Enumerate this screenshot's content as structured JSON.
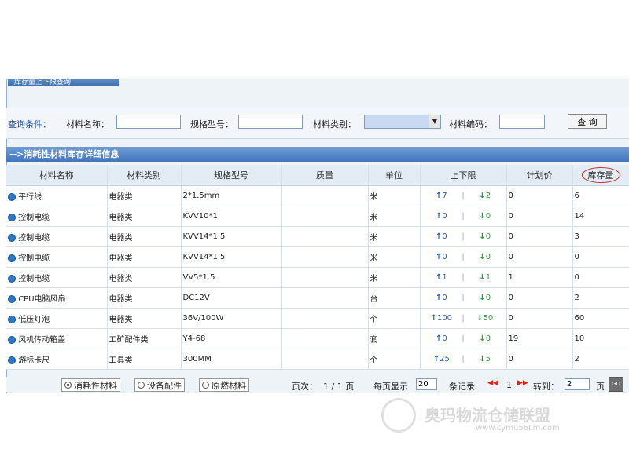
{
  "header_tab": "库存量上下限查询",
  "query": {
    "label": "查询条件：",
    "material_name_label": "材料名称：",
    "material_name_value": "",
    "spec_label": "规格型号：",
    "spec_value": "",
    "category_label": "材料类别：",
    "category_value": "",
    "code_label": "材料编码：",
    "code_value": "",
    "search_button": "查 询"
  },
  "section_title": "-->消耗性材料库存详细信息",
  "table": {
    "headers": [
      "材料名称",
      "材料类别",
      "规格型号",
      "质量",
      "单位",
      "上下限",
      "计划价",
      "库存量"
    ],
    "rows": [
      {
        "name": "平行线",
        "category": "电器类",
        "spec": "2*1.5mm",
        "quality": "",
        "unit": "米",
        "upper": "7",
        "lower": "2",
        "price": "0",
        "stock": "6"
      },
      {
        "name": "控制电缆",
        "category": "电器类",
        "spec": "KVV10*1",
        "quality": "",
        "unit": "米",
        "upper": "0",
        "lower": "0",
        "price": "0",
        "stock": "14"
      },
      {
        "name": "控制电缆",
        "category": "电器类",
        "spec": "KVV14*1.5",
        "quality": "",
        "unit": "米",
        "upper": "0",
        "lower": "0",
        "price": "0",
        "stock": "3"
      },
      {
        "name": "控制电缆",
        "category": "电器类",
        "spec": "KVV14*1.5",
        "quality": "",
        "unit": "米",
        "upper": "0",
        "lower": "0",
        "price": "0",
        "stock": "0"
      },
      {
        "name": "控制电缆",
        "category": "电器类",
        "spec": "VV5*1.5",
        "quality": "",
        "unit": "米",
        "upper": "1",
        "lower": "1",
        "price": "1",
        "stock": "0"
      },
      {
        "name": "CPU电脑风扇",
        "category": "电器类",
        "spec": "DC12V",
        "quality": "",
        "unit": "台",
        "upper": "0",
        "lower": "0",
        "price": "0",
        "stock": "2"
      },
      {
        "name": "低压灯泡",
        "category": "电器类",
        "spec": "36V/100W",
        "quality": "",
        "unit": "个",
        "upper": "100",
        "lower": "50",
        "price": "0",
        "stock": "60"
      },
      {
        "name": "风机传动箱盖",
        "category": "工矿配件类",
        "spec": "Y4-68",
        "quality": "",
        "unit": "套",
        "upper": "0",
        "lower": "0",
        "price": "19",
        "stock": "10"
      },
      {
        "name": "游标卡尺",
        "category": "工具类",
        "spec": "300MM",
        "quality": "",
        "unit": "个",
        "upper": "25",
        "lower": "5",
        "price": "0",
        "stock": "2"
      }
    ]
  },
  "footer": {
    "radio_consumable": "消耗性材料",
    "radio_equipment": "设备配件",
    "radio_raw": "原燃材料",
    "page_label": "页次：",
    "page_value": "1 / 1 页",
    "per_page_label": "每页显示",
    "per_page_value": "20",
    "records_label": "条记录",
    "current_page": "1",
    "goto_label": "转到：",
    "goto_value": "2",
    "page_suffix": "页",
    "go_label": "GO"
  },
  "watermark": {
    "text": "奥玛物流仓储联盟",
    "url": "www.cymu56Lm.com"
  }
}
